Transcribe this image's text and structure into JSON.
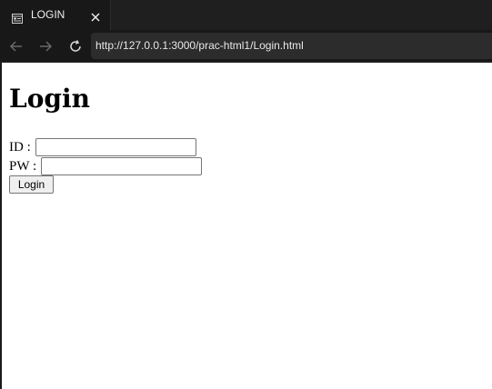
{
  "browser": {
    "tab": {
      "title": "LOGIN",
      "icon": "page-icon",
      "close_icon": "close-icon"
    },
    "toolbar": {
      "back_icon": "arrow-left-icon",
      "forward_icon": "arrow-right-icon",
      "reload_icon": "reload-icon",
      "url": "http://127.0.0.1:3000/prac-html1/Login.html"
    },
    "colors": {
      "chrome_bg": "#1f1f1f",
      "toolbar_bg": "#181818",
      "address_bg": "#2c2c2c",
      "chrome_text": "#f0f0f0"
    }
  },
  "page": {
    "heading": "Login",
    "form": {
      "id_label": "ID :",
      "id_value": "",
      "pw_label": "PW :",
      "pw_value": "",
      "submit_label": "Login"
    }
  }
}
